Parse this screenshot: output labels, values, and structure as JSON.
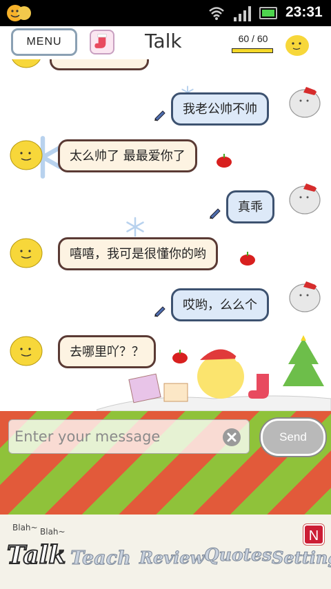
{
  "status_bar": {
    "time": "23:31"
  },
  "header": {
    "menu_label": "MENU",
    "title": "Talk",
    "energy": "60 / 60",
    "energy_fraction": 1.0
  },
  "chat": {
    "messages": [
      {
        "sender": "user",
        "text": "我老公帅不帅"
      },
      {
        "sender": "bot",
        "text": "太么帅了 最最爱你了"
      },
      {
        "sender": "user",
        "text": "真乖"
      },
      {
        "sender": "bot",
        "text": "嘻嘻，我可是很懂你的哟"
      },
      {
        "sender": "user",
        "text": "哎哟，么么个"
      },
      {
        "sender": "bot",
        "text": "去哪里吖？？"
      }
    ]
  },
  "composer": {
    "placeholder": "Enter your message",
    "send_label": "Send"
  },
  "nav": {
    "blah1": "Blah~",
    "blah2": "Blah~",
    "tabs": [
      "Talk",
      "Teach",
      "Review",
      "Quotes",
      "Setting"
    ],
    "badge": "N"
  },
  "colors": {
    "user_bubble": "#dde9f8",
    "bot_bubble": "#fdf3e2",
    "stripe_red": "#e25a3a",
    "stripe_green": "#8fc23a",
    "badge_red": "#cc1d34"
  }
}
